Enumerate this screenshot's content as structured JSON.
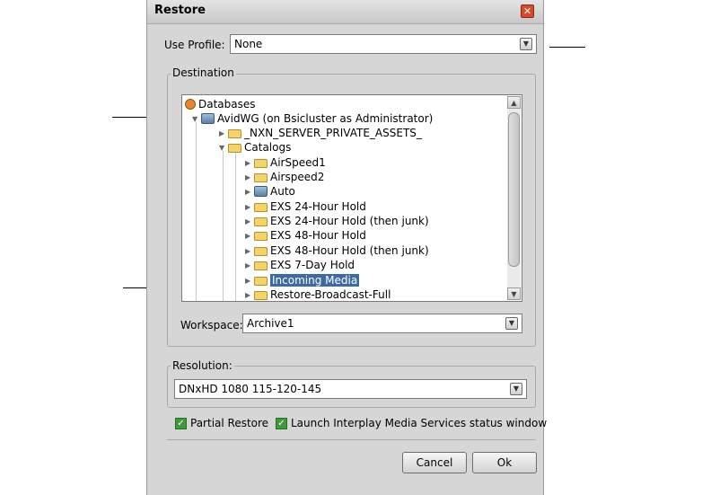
{
  "dialog": {
    "title": "Restore"
  },
  "profile": {
    "label": "Use Profile:",
    "value": "None"
  },
  "destination": {
    "legend": "Destination",
    "tree": [
      {
        "label": "Databases",
        "icon": "database-icon",
        "level": 0
      },
      {
        "label": "AvidWG (on Bsicluster as Administrator)",
        "icon": "workgroup-icon",
        "level": 1
      },
      {
        "label": "_NXN_SERVER_PRIVATE_ASSETS_",
        "icon": "folder-icon",
        "level": 2
      },
      {
        "label": "Catalogs",
        "icon": "folder-icon",
        "level": 2
      },
      {
        "label": "AirSpeed1",
        "icon": "folder-icon",
        "level": 3
      },
      {
        "label": "Airspeed2",
        "icon": "folder-icon",
        "level": 3
      },
      {
        "label": "Auto",
        "icon": "workgroup-icon",
        "level": 3
      },
      {
        "label": "EXS 24-Hour Hold",
        "icon": "folder-icon",
        "level": 3
      },
      {
        "label": "EXS 24-Hour Hold (then junk)",
        "icon": "folder-icon",
        "level": 3
      },
      {
        "label": "EXS 48-Hour Hold",
        "icon": "folder-icon",
        "level": 3
      },
      {
        "label": "EXS 48-Hour Hold (then junk)",
        "icon": "folder-icon",
        "level": 3
      },
      {
        "label": "EXS 7-Day Hold",
        "icon": "folder-icon",
        "level": 3
      },
      {
        "label": "Incoming Media",
        "icon": "folder-icon",
        "level": 3,
        "selected": true
      },
      {
        "label": "Restore-Broadcast-Full",
        "icon": "folder-icon",
        "level": 3
      }
    ],
    "workspace_label": "Workspace:",
    "workspace_value": "Archive1"
  },
  "resolution": {
    "legend": "Resolution:",
    "value": "DNxHD 1080 115-120-145"
  },
  "options": {
    "partial_restore": {
      "label": "Partial Restore",
      "checked": true
    },
    "launch_status": {
      "label": "Launch Interplay Media Services status window",
      "checked": true
    }
  },
  "buttons": {
    "cancel": "Cancel",
    "ok": "Ok"
  },
  "colors": {
    "selection": "#3d6aa3",
    "checkbox": "#3e9a3a",
    "close": "#d84a2a"
  }
}
